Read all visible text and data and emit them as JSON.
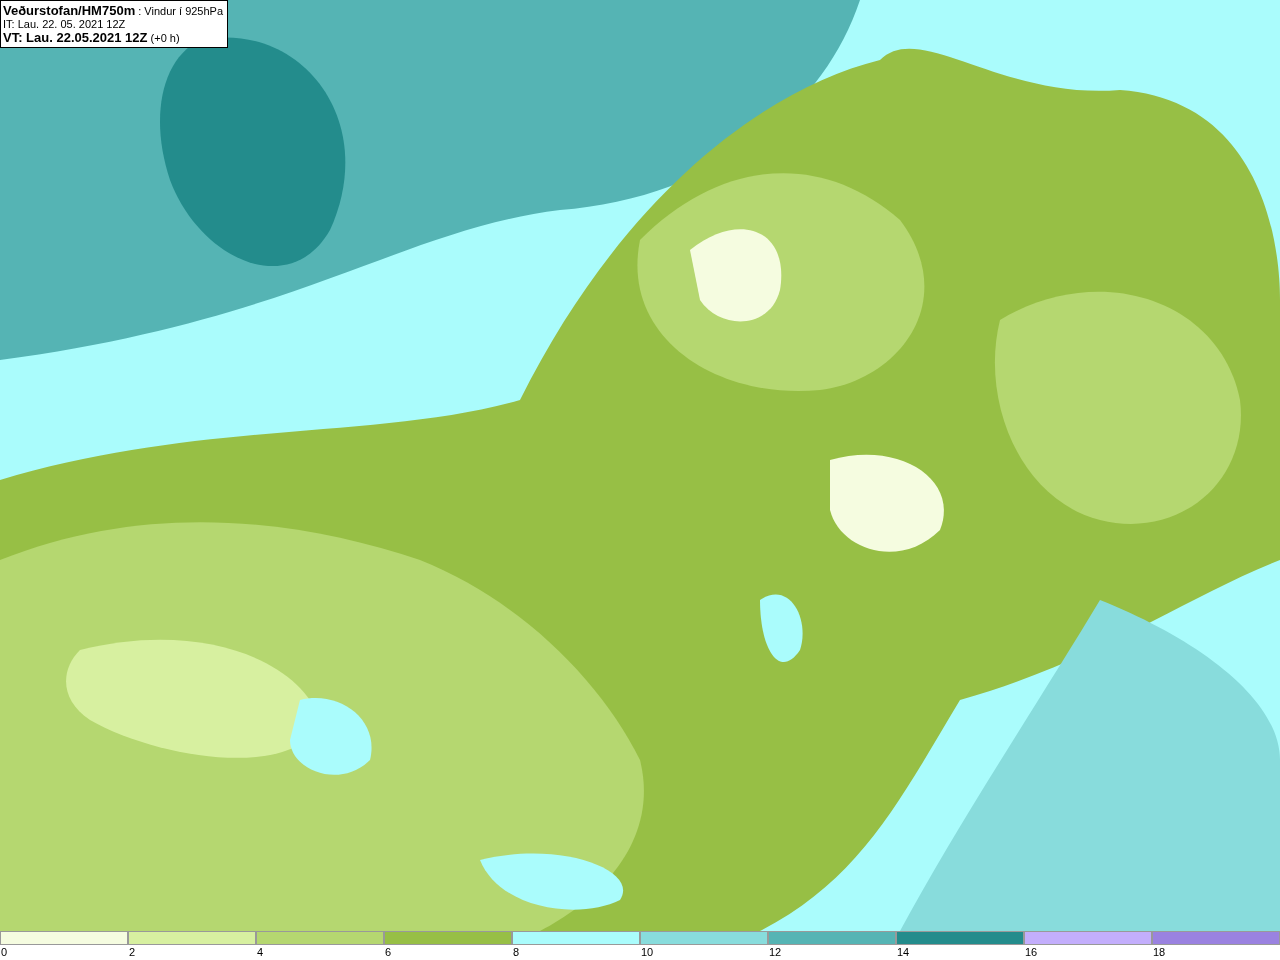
{
  "title_box": {
    "lines": [
      "**Veðurstofan/HM750m** : Vindur í 925hPa",
      "IT: Lau. 22. 05. 2021 12Z",
      "**VT: Lau. 22.05.2021 12Z** (+0 h)"
    ]
  },
  "legend": [
    {
      "label": "0",
      "color": "#f5fce0"
    },
    {
      "label": "2",
      "color": "#d7f0a0"
    },
    {
      "label": "4",
      "color": "#b5d770"
    },
    {
      "label": "6",
      "color": "#97bf45"
    },
    {
      "label": "8",
      "color": "#aafcfc"
    },
    {
      "label": "10",
      "color": "#88dcdc"
    },
    {
      "label": "12",
      "color": "#55b4b4"
    },
    {
      "label": "14",
      "color": "#238c8c"
    },
    {
      "label": "16",
      "color": "#c3aefc"
    },
    {
      "label": "18",
      "color": "#9a82e0"
    }
  ]
}
